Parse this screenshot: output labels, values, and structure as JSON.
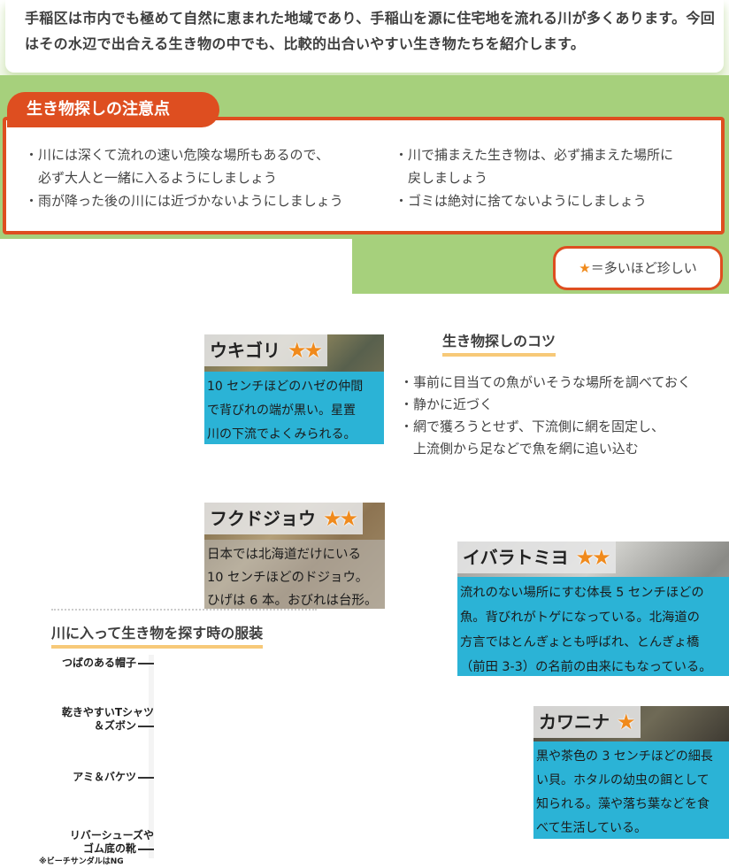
{
  "intro": {
    "text": "手稲区は市内でも極めて自然に恵まれた地域であり、手稲山を源に住宅地を流れる川が多くあります。今回はその水辺で出合える生き物の中でも、比較的出合いやすい生き物たちを紹介します。"
  },
  "caution": {
    "title": "生き物探しの注意点",
    "left": [
      "・川には深くて流れの速い危険な場所もあるので、",
      "　必ず大人と一緒に入るようにしましょう",
      "・雨が降った後の川には近づかないようにしましょう"
    ],
    "right": [
      "・川で捕まえた生き物は、必ず捕まえた場所に",
      "　戻しましょう",
      "・ゴミは絶対に捨てないようにしましょう"
    ]
  },
  "legend": {
    "star": "★",
    "text": "＝多いほど珍しい"
  },
  "creatures": [
    {
      "name": "ウキゴリ",
      "stars": "★★",
      "lines": [
        "10 センチほどのハゼの仲間",
        "で背びれの端が黒い。星置",
        "川の下流でよくみられる。"
      ]
    },
    {
      "name": "フクドジョウ",
      "stars": "★★",
      "lines": [
        "日本では北海道だけにいる",
        "10 センチほどのドジョウ。",
        "ひげは 6 本。おびれは台形。"
      ]
    },
    {
      "name": "イバラトミヨ",
      "stars": "★★",
      "lines": [
        "流れのない場所にすむ体長 5 センチほどの",
        "魚。背びれがトゲになっている。北海道の",
        "方言ではとんぎょとも呼ばれ、とんぎょ橋",
        "（前田 3-3）の名前の由来にもなっている。"
      ]
    },
    {
      "name": "カワニナ",
      "stars": "★",
      "lines": [
        "黒や茶色の 3 センチほどの細長",
        "い貝。ホタルの幼虫の餌として",
        "知られる。藻や落ち葉などを食",
        "べて生活している。"
      ]
    }
  ],
  "tips": {
    "heading": "生き物探しのコツ",
    "items": [
      "・事前に目当ての魚がいそうな場所を調べておく",
      "・静かに近づく",
      "・網で獲ろうとせず、下流側に網を固定し、",
      "　上流側から足などで魚を網に追い込む"
    ]
  },
  "outfit": {
    "heading": "川に入って生き物を探す時の服装",
    "hat": "つばのある帽子",
    "shirt_line1": "乾きやすいTシャツ",
    "shirt_line2": "＆ズボン",
    "net": "アミ＆バケツ",
    "shoes_line1": "リバーシューズや",
    "shoes_line2": "ゴム底の靴",
    "note": "※ビーチサンダルはNG"
  },
  "colors": {
    "accent": "#de4e20",
    "green": "#a6d07c",
    "caption_blue": "#2bb3d6",
    "star": "#f08a1c",
    "underline": "#f7c978"
  }
}
